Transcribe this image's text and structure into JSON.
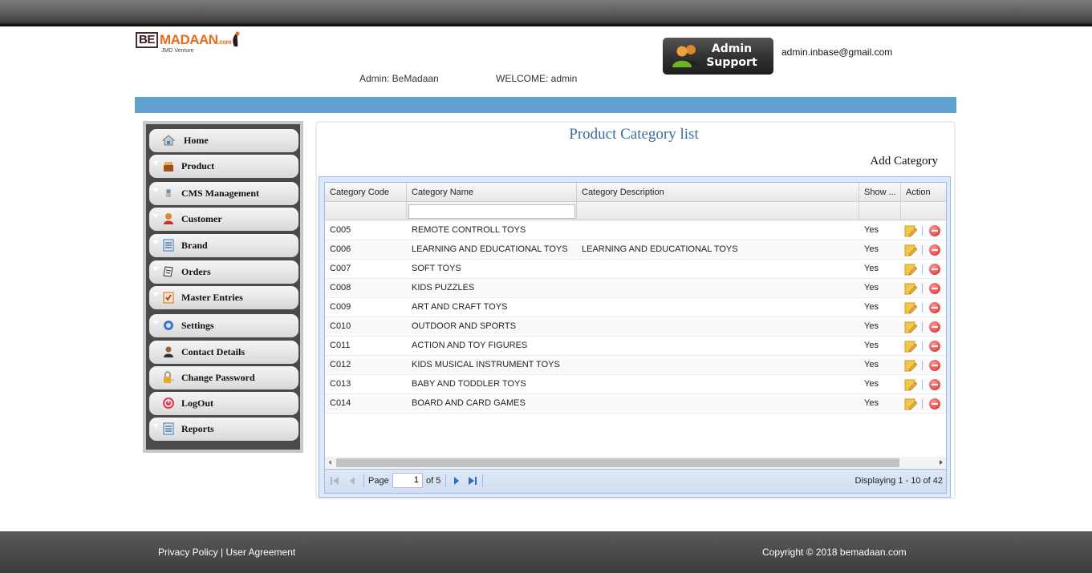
{
  "header": {
    "logo": {
      "be": "BE",
      "madaan": "MADAAN",
      "dotcom": ".com",
      "tagline": "JMD Venture"
    },
    "support_button": {
      "line1": "Admin",
      "line2": "Support"
    },
    "email": "admin.inbase@gmail.com",
    "admin_label": "Admin: BeMadaan",
    "welcome_label": "WELCOME: admin"
  },
  "sidebar": {
    "items": [
      {
        "label": "Home",
        "icon": "home-icon",
        "expandable": false
      },
      {
        "label": "Product",
        "icon": "product-box-icon",
        "expandable": true
      },
      {
        "label": "CMS Management",
        "icon": "cms-tools-icon",
        "expandable": true
      },
      {
        "label": "Customer",
        "icon": "customer-icon",
        "expandable": true
      },
      {
        "label": "Brand",
        "icon": "list-icon",
        "expandable": true
      },
      {
        "label": "Orders",
        "icon": "orders-icon",
        "expandable": true
      },
      {
        "label": "Master Entries",
        "icon": "checklist-icon",
        "expandable": true
      },
      {
        "label": "Settings",
        "icon": "gear-icon",
        "expandable": true
      },
      {
        "label": "Contact Details",
        "icon": "contact-person-icon",
        "expandable": false
      },
      {
        "label": "Change Password",
        "icon": "lock-key-icon",
        "expandable": false
      },
      {
        "label": "LogOut",
        "icon": "power-icon",
        "expandable": false
      },
      {
        "label": "Reports",
        "icon": "report-list-icon",
        "expandable": true
      }
    ]
  },
  "main": {
    "title": "Product Category list",
    "add_button": "Add Category",
    "grid": {
      "columns": [
        "Category Code",
        "Category Name",
        "Category Description",
        "Show ...",
        "Action"
      ],
      "filter": {
        "category_name": ""
      },
      "rows": [
        {
          "code": "C005",
          "name": "REMOTE CONTROLL TOYS",
          "description": "",
          "show": "Yes"
        },
        {
          "code": "C006",
          "name": "LEARNING AND EDUCATIONAL TOYS",
          "description": "LEARNING AND EDUCATIONAL TOYS",
          "show": "Yes"
        },
        {
          "code": "C007",
          "name": "SOFT TOYS",
          "description": "",
          "show": "Yes"
        },
        {
          "code": "C008",
          "name": "KIDS PUZZLES",
          "description": "",
          "show": "Yes"
        },
        {
          "code": "C009",
          "name": "ART AND CRAFT TOYS",
          "description": "",
          "show": "Yes"
        },
        {
          "code": "C010",
          "name": "OUTDOOR AND SPORTS",
          "description": "",
          "show": "Yes"
        },
        {
          "code": "C011",
          "name": "ACTION AND TOY FIGURES",
          "description": "",
          "show": "Yes"
        },
        {
          "code": "C012",
          "name": "KIDS MUSICAL INSTRUMENT TOYS",
          "description": "",
          "show": "Yes"
        },
        {
          "code": "C013",
          "name": "BABY AND TODDLER TOYS",
          "description": "",
          "show": "Yes"
        },
        {
          "code": "C014",
          "name": "BOARD AND CARD GAMES",
          "description": "",
          "show": "Yes"
        }
      ],
      "pager": {
        "page_label": "Page",
        "current_page": "1",
        "of_label": "of 5",
        "display_text": "Displaying 1 - 10 of 42"
      }
    }
  },
  "footer": {
    "privacy": "Privacy Policy",
    "separator": "|",
    "agreement": "User Agreement",
    "copyright": "Copyright © 2018 bemadaan.com"
  },
  "colors": {
    "accent_bar": "#5fa2d2",
    "title_blue": "#3a6ba3",
    "logo_orange": "#ea6a1a",
    "grid_border": "#99bbe8"
  }
}
